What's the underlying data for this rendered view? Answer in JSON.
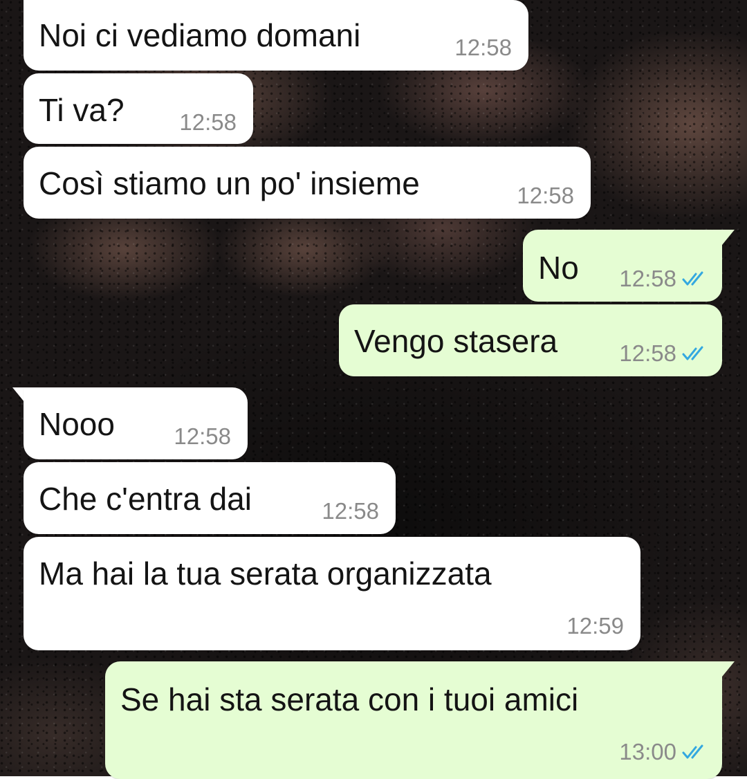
{
  "chat": {
    "messages": [
      {
        "direction": "in",
        "text": "Noi ci vediamo domani",
        "time": "12:58"
      },
      {
        "direction": "in",
        "text": "Ti va?",
        "time": "12:58"
      },
      {
        "direction": "in",
        "text": "Così stiamo un po' insieme",
        "time": "12:58"
      },
      {
        "direction": "out",
        "text": "No",
        "time": "12:58",
        "status": "read",
        "status_icon": "double-check-icon"
      },
      {
        "direction": "out",
        "text": "Vengo stasera",
        "time": "12:58",
        "status": "read",
        "status_icon": "double-check-icon"
      },
      {
        "direction": "in",
        "text": "Nooo",
        "time": "12:58"
      },
      {
        "direction": "in",
        "text": "Che c'entra dai",
        "time": "12:58"
      },
      {
        "direction": "in",
        "text": "Ma hai la tua serata organizzata",
        "time": "12:59"
      },
      {
        "direction": "out",
        "text": "Se hai sta serata con i tuoi amici",
        "time": "13:00",
        "status": "read",
        "status_icon": "double-check-icon"
      }
    ]
  },
  "colors": {
    "incoming_bubble": "#ffffff",
    "outgoing_bubble": "#e5fdd3",
    "read_tick": "#34a8e0",
    "timestamp": "#8a8a8a"
  }
}
